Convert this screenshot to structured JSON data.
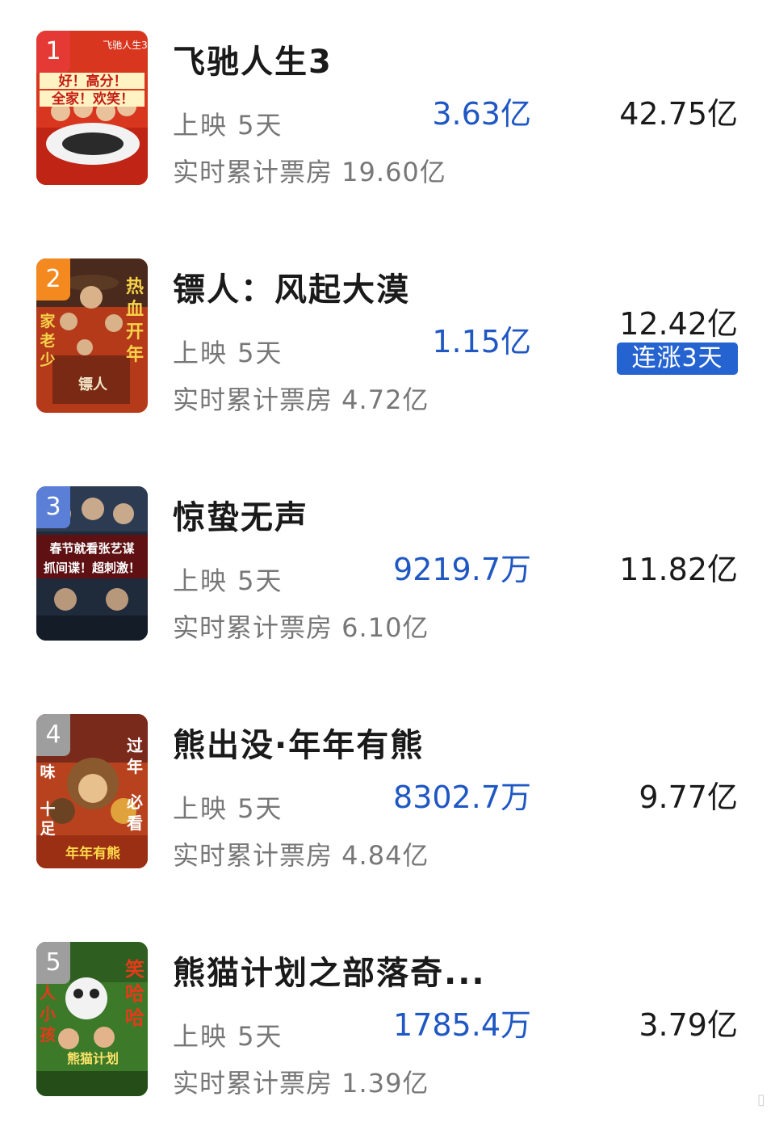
{
  "movies": [
    {
      "rank": "1",
      "rank_color": "#e53935",
      "title": "飞驰人生3",
      "days": "上映 5天",
      "cumulative": "实时累计票房 19.60亿",
      "daily": "3.63亿",
      "total": "42.75亿",
      "poster_text": [
        "好！高分！",
        "全家！欢笑！"
      ],
      "poster_corner": "飞驰人生3",
      "poster_bg": "#d8361f"
    },
    {
      "rank": "2",
      "rank_color": "#f4891f",
      "title": "镖人：风起大漠",
      "days": "上映 5天",
      "cumulative": "实时累计票房 4.72亿",
      "daily": "1.15亿",
      "total": "12.42亿",
      "badge": "连涨3天",
      "poster_text": [
        "热",
        "血",
        "开",
        "年"
      ],
      "poster_side": [
        "家",
        "老",
        "少"
      ],
      "poster_logo": "镖人",
      "poster_bg": "#b53a1a"
    },
    {
      "rank": "3",
      "rank_color": "#5b7fd6",
      "title": "惊蛰无声",
      "days": "上映 5天",
      "cumulative": "实时累计票房 6.10亿",
      "daily": "9219.7万",
      "total": "11.82亿",
      "poster_text": [
        "春节就看张艺谋",
        "抓间谍！超刺激！"
      ],
      "poster_bg": "#1f2a3a"
    },
    {
      "rank": "4",
      "rank_color": "#9e9e9e",
      "title": "熊出没·年年有熊",
      "days": "上映 5天",
      "cumulative": "实时累计票房 4.84亿",
      "daily": "8302.7万",
      "total": "9.77亿",
      "poster_text": [
        "过",
        "年",
        "必",
        "看"
      ],
      "poster_side": [
        "味",
        "十",
        "足"
      ],
      "poster_logo": "年年有熊",
      "poster_bg": "#b8421e"
    },
    {
      "rank": "5",
      "rank_color": "#9e9e9e",
      "title": "熊猫计划之部落奇...",
      "days": "上映 5天",
      "cumulative": "实时累计票房 1.39亿",
      "daily": "1785.4万",
      "total": "3.79亿",
      "poster_text": [
        "笑",
        "哈",
        "哈"
      ],
      "poster_side": [
        "人",
        "小",
        "孩"
      ],
      "poster_logo": "熊猫计划",
      "poster_bg": "#3c7a2a"
    }
  ]
}
